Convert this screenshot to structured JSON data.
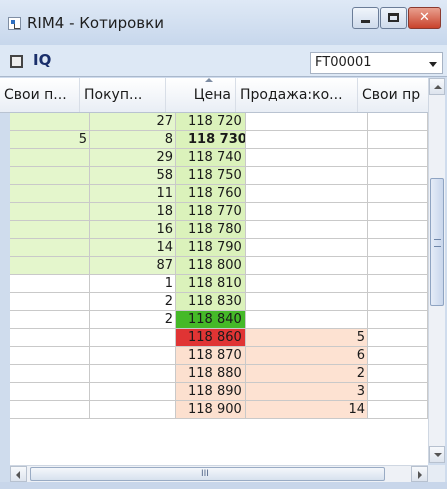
{
  "window": {
    "title": "RIM4 - Котировки",
    "close_glyph": "✕"
  },
  "toolbar": {
    "label": "IQ",
    "account_value": "FT00001"
  },
  "table": {
    "columns": [
      "Свои п...",
      "Покуп...",
      "Цена",
      "Продажа:ко...",
      "Свои пр"
    ],
    "rows": [
      {
        "own_buy": "",
        "buy": "27",
        "price": "118 720",
        "sell": "",
        "own_sell": "",
        "type": "bid"
      },
      {
        "own_buy": "5",
        "buy": "8",
        "price": "118 730",
        "sell": "",
        "own_sell": "",
        "type": "bid",
        "bold": true
      },
      {
        "own_buy": "",
        "buy": "29",
        "price": "118 740",
        "sell": "",
        "own_sell": "",
        "type": "bid"
      },
      {
        "own_buy": "",
        "buy": "58",
        "price": "118 750",
        "sell": "",
        "own_sell": "",
        "type": "bid"
      },
      {
        "own_buy": "",
        "buy": "11",
        "price": "118 760",
        "sell": "",
        "own_sell": "",
        "type": "bid"
      },
      {
        "own_buy": "",
        "buy": "18",
        "price": "118 770",
        "sell": "",
        "own_sell": "",
        "type": "bid"
      },
      {
        "own_buy": "",
        "buy": "16",
        "price": "118 780",
        "sell": "",
        "own_sell": "",
        "type": "bid"
      },
      {
        "own_buy": "",
        "buy": "14",
        "price": "118 790",
        "sell": "",
        "own_sell": "",
        "type": "bid"
      },
      {
        "own_buy": "",
        "buy": "87",
        "price": "118 800",
        "sell": "",
        "own_sell": "",
        "type": "bid"
      },
      {
        "own_buy": "",
        "buy": "1",
        "price": "118 810",
        "sell": "",
        "own_sell": "",
        "type": "bid-white",
        "selected": true
      },
      {
        "own_buy": "",
        "buy": "2",
        "price": "118 830",
        "sell": "",
        "own_sell": "",
        "type": "bid-white"
      },
      {
        "own_buy": "",
        "buy": "2",
        "price": "118 840",
        "sell": "",
        "own_sell": "",
        "type": "best-bid"
      },
      {
        "own_buy": "",
        "buy": "",
        "price": "118 860",
        "sell": "5",
        "own_sell": "",
        "type": "best-ask"
      },
      {
        "own_buy": "",
        "buy": "",
        "price": "118 870",
        "sell": "6",
        "own_sell": "",
        "type": "ask"
      },
      {
        "own_buy": "",
        "buy": "",
        "price": "118 880",
        "sell": "2",
        "own_sell": "",
        "type": "ask"
      },
      {
        "own_buy": "",
        "buy": "",
        "price": "118 890",
        "sell": "3",
        "own_sell": "",
        "type": "ask"
      },
      {
        "own_buy": "",
        "buy": "",
        "price": "118 900",
        "sell": "14",
        "own_sell": "",
        "type": "ask"
      }
    ]
  },
  "colors": {
    "bid": "#e4f6cc",
    "bid_price": "#dbf2bb",
    "best_bid": "#45b928",
    "best_ask": "#e03434",
    "ask": "#fde2d2",
    "ask_price": "#fce0cf"
  },
  "scrollbars": {
    "horizontal_grip": "III"
  }
}
